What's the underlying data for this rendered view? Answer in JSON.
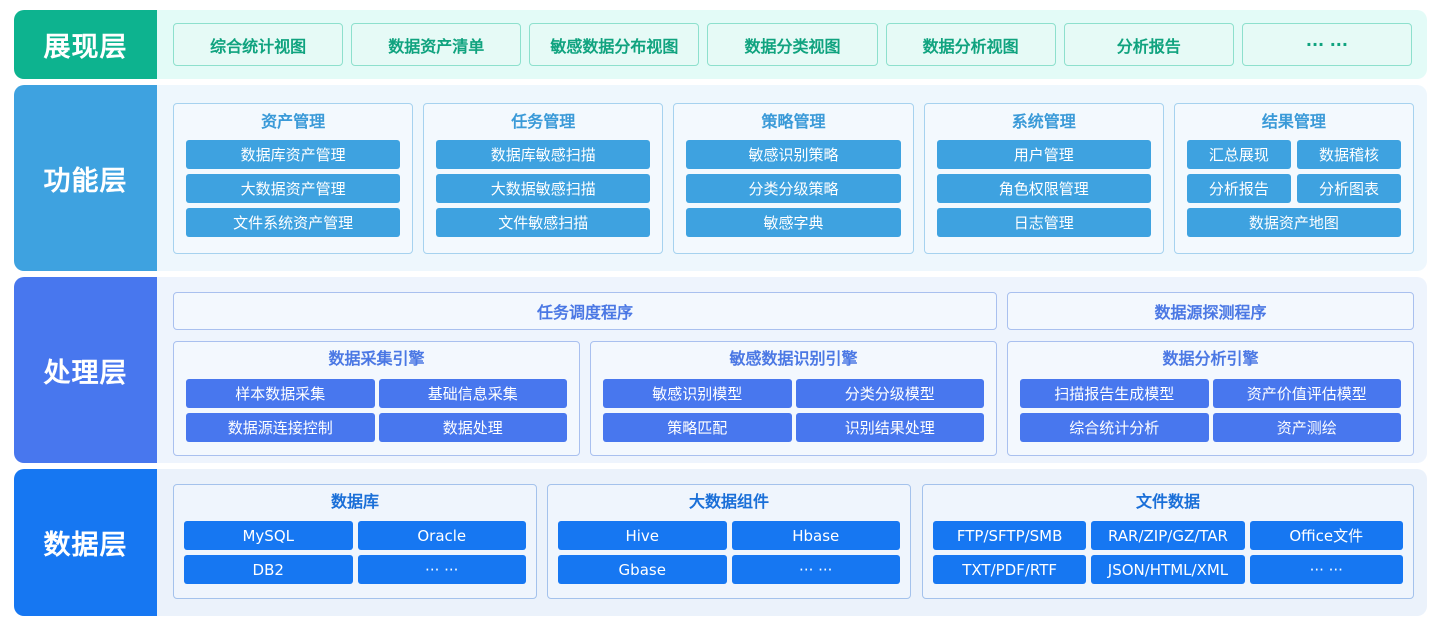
{
  "colors": {
    "presentation": "#0db38f",
    "function": "#3ea2e0",
    "processing": "#4877ee",
    "data": "#1677f2"
  },
  "presentation_layer": {
    "label": "展现层",
    "items": [
      "综合统计视图",
      "数据资产清单",
      "敏感数据分布视图",
      "数据分类视图",
      "数据分析视图",
      "分析报告",
      "··· ···"
    ]
  },
  "function_layer": {
    "label": "功能层",
    "groups": [
      {
        "title": "资产管理",
        "items": [
          "数据库资产管理",
          "大数据资产管理",
          "文件系统资产管理"
        ]
      },
      {
        "title": "任务管理",
        "items": [
          "数据库敏感扫描",
          "大数据敏感扫描",
          "文件敏感扫描"
        ]
      },
      {
        "title": "策略管理",
        "items": [
          "敏感识别策略",
          "分类分级策略",
          "敏感字典"
        ]
      },
      {
        "title": "系统管理",
        "items": [
          "用户管理",
          "角色权限管理",
          "日志管理"
        ]
      },
      {
        "title": "结果管理",
        "items": [
          "汇总展现",
          "数据稽核",
          "分析报告",
          "分析图表",
          "数据资产地图"
        ]
      }
    ]
  },
  "processing_layer": {
    "label": "处理层",
    "bars": [
      "任务调度程序",
      "数据源探测程序"
    ],
    "groups": [
      {
        "title": "数据采集引擎",
        "items": [
          "样本数据采集",
          "基础信息采集",
          "数据源连接控制",
          "数据处理"
        ]
      },
      {
        "title": "敏感数据识别引擎",
        "items": [
          "敏感识别模型",
          "分类分级模型",
          "策略匹配",
          "识别结果处理"
        ]
      },
      {
        "title": "数据分析引擎",
        "items": [
          "扫描报告生成模型",
          "资产价值评估模型",
          "综合统计分析",
          "资产测绘"
        ]
      }
    ]
  },
  "data_layer": {
    "label": "数据层",
    "groups": [
      {
        "title": "数据库",
        "items": [
          "MySQL",
          "Oracle",
          "DB2",
          "··· ···"
        ]
      },
      {
        "title": "大数据组件",
        "items": [
          "Hive",
          "Hbase",
          "Gbase",
          "··· ···"
        ]
      },
      {
        "title": "文件数据",
        "items": [
          "FTP/SFTP/SMB",
          "RAR/ZIP/GZ/TAR",
          "Office文件",
          "TXT/PDF/RTF",
          "JSON/HTML/XML",
          "··· ···"
        ]
      }
    ]
  }
}
